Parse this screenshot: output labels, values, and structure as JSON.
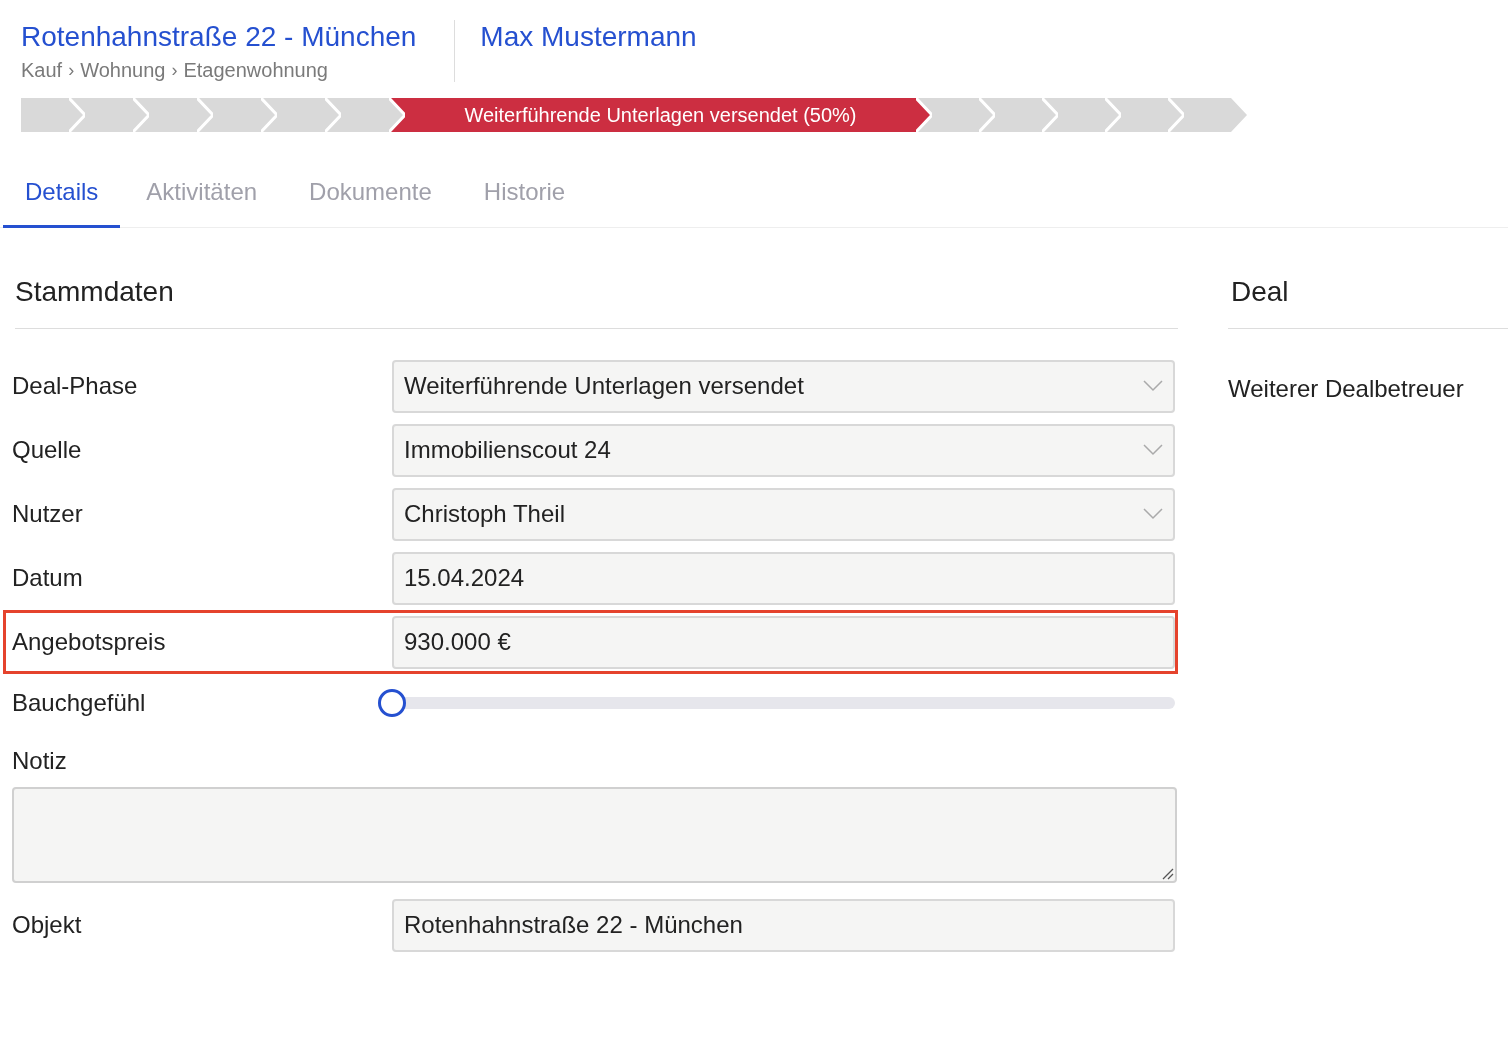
{
  "header": {
    "title": "Rotenhahnstraße 22 - München",
    "breadcrumb": [
      "Kauf",
      "›",
      "Wohnung",
      "›",
      "Etagenwohnung"
    ],
    "contact": "Max Mustermann"
  },
  "pipeline": [
    {
      "selected": false
    },
    {
      "selected": false
    },
    {
      "selected": false
    },
    {
      "selected": false
    },
    {
      "selected": false
    },
    {
      "selected": false
    },
    {
      "label": "Weiterführende Unterlagen versendet (50%)",
      "selected": true
    },
    {
      "selected": false
    },
    {
      "selected": false
    },
    {
      "selected": false
    },
    {
      "selected": false
    },
    {
      "selected": false
    }
  ],
  "tabs": [
    {
      "label": "Details",
      "selected": true
    },
    {
      "label": "Aktivitäten",
      "selected": false
    },
    {
      "label": "Dokumente",
      "selected": false
    },
    {
      "label": "Historie",
      "selected": false
    }
  ],
  "stammdaten": {
    "title": "Stammdaten",
    "fields": [
      {
        "kind": "select",
        "label": "Deal-Phase",
        "value": "Weiterführende Unterlagen versendet",
        "highlighted": false
      },
      {
        "kind": "select",
        "label": "Quelle",
        "value": "Immobilienscout 24",
        "highlighted": false
      },
      {
        "kind": "select",
        "label": "Nutzer",
        "value": "Christoph Theil",
        "highlighted": false
      },
      {
        "kind": "input",
        "label": "Datum",
        "value": "15.04.2024",
        "highlighted": false
      },
      {
        "kind": "input",
        "label": "Angebotspreis",
        "value": "930.000 €",
        "highlighted": true
      },
      {
        "kind": "slider",
        "label": "Bauchgefühl",
        "level": 0,
        "highlighted": false
      },
      {
        "kind": "textarea",
        "label": "Notiz",
        "highlighted": false
      },
      {
        "kind": "input",
        "label": "Objekt",
        "value": "Rotenhahnstraße 22 - München",
        "highlighted": false
      }
    ]
  },
  "deal": {
    "title": "Deal",
    "fields": [
      {
        "label": "Weiterer Dealbetreuer"
      }
    ]
  }
}
